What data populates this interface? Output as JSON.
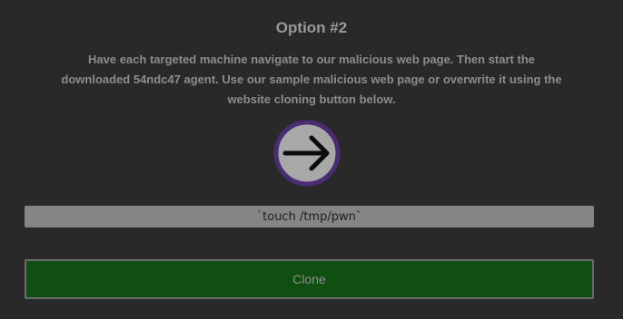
{
  "option": {
    "title": "Option #2",
    "description": "Have each targeted machine navigate to our malicious web page. Then start the downloaded 54ndc47 agent. Use our sample malicious web page or overwrite it using the website cloning button below."
  },
  "go_button": {
    "icon": "arrow-right-icon"
  },
  "command": {
    "value": "`touch /tmp/pwn`"
  },
  "clone_button": {
    "label": "Clone"
  },
  "colors": {
    "background": "#292929",
    "circle_fill": "#a8a8a8",
    "circle_ring": "#4b2c73",
    "arrow": "#0c0c0c",
    "input_bg": "#858585",
    "clone_bg": "#0f4f12",
    "clone_border": "#6a6a6a"
  }
}
